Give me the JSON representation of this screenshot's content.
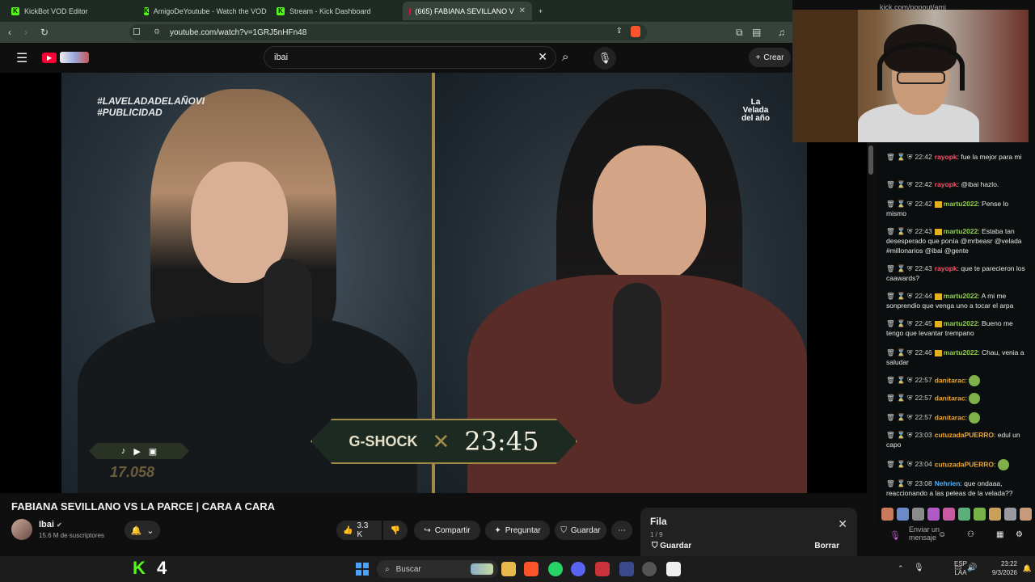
{
  "browser": {
    "tabs": [
      {
        "title": "KickBot VOD Editor",
        "icon": "kick-icon"
      },
      {
        "title": "AmigoDeYoutube - Watch the VOD o",
        "icon": "kick-icon"
      },
      {
        "title": "Stream - Kick Dashboard",
        "icon": "kick-icon"
      },
      {
        "title": "(665) FABIANA SEVILLANO V",
        "icon": "youtube-icon",
        "active": true
      }
    ],
    "new_tab": "+",
    "url": "youtube.com/watch?v=1GRJ5nHFn48"
  },
  "youtube": {
    "search_value": "ibai",
    "create_label": "Crear",
    "video": {
      "title": "FABIANA SEVILLANO VS LA PARCE | CARA A CARA",
      "hashtag_line1": "#LAVELADADELAÑOVI",
      "hashtag_line2": "#PUBLICIDAD",
      "event_logo_line1": "La",
      "event_logo_line2": "Velada",
      "event_logo_line3": "del año",
      "sponsor": "G-SHOCK",
      "countdown": "23:45",
      "counter": "17.058"
    },
    "channel": {
      "name": "Ibai",
      "subscribers": "15.6 M de suscriptores"
    },
    "actions": {
      "likes": "3.3 K",
      "share": "Compartir",
      "ask": "Preguntar",
      "save": "Guardar"
    },
    "queue": {
      "title": "Fila",
      "count": "1 / 9",
      "save": "Guardar",
      "clear": "Borrar"
    }
  },
  "kick": {
    "url": "kick.com/popout/ami",
    "chat": [
      {
        "time": "22:42",
        "user": "rayopk",
        "user_color": "#ff4f6a",
        "text": "fue la mejor para mi",
        "badge": false
      },
      {
        "time": "22:42",
        "user": "rayopk",
        "user_color": "#ff4f6a",
        "text": "@ibai hazlo.",
        "badge": false
      },
      {
        "time": "22:42",
        "user": "martu2022",
        "user_color": "#8fd44a",
        "text": "Pense lo mismo",
        "badge": true
      },
      {
        "time": "22:43",
        "user": "martu2022",
        "user_color": "#8fd44a",
        "text": "Estaba tan desesperado que ponía @mrbeasr @velada #millonarios @ibai @gente",
        "badge": true
      },
      {
        "time": "22:43",
        "user": "rayopk",
        "user_color": "#ff4f6a",
        "text": "que te parecieron los caawards?",
        "badge": false
      },
      {
        "time": "22:44",
        "user": "martu2022",
        "user_color": "#8fd44a",
        "text": "A mi me sonprendio que venga uno a tocar el arpa",
        "badge": true
      },
      {
        "time": "22:45",
        "user": "martu2022",
        "user_color": "#8fd44a",
        "text": "Bueno me tengo que levantar trempano",
        "badge": true
      },
      {
        "time": "22:46",
        "user": "martu2022",
        "user_color": "#8fd44a",
        "text": "Chau, venia a saludar",
        "badge": true
      },
      {
        "time": "22:57",
        "user": "danitarac",
        "user_color": "#f5a623",
        "text": "",
        "emote": true,
        "badge": false
      },
      {
        "time": "22:57",
        "user": "danitarac",
        "user_color": "#f5a623",
        "text": "",
        "emote": true,
        "badge": false
      },
      {
        "time": "22:57",
        "user": "danitarac",
        "user_color": "#f5a623",
        "text": "",
        "emote": true,
        "badge": false
      },
      {
        "time": "23:03",
        "user": "cutuzadaPUERRO",
        "user_color": "#f5a623",
        "text": "edul un capo",
        "badge": false
      },
      {
        "time": "23:04",
        "user": "cutuzadaPUERRO",
        "user_color": "#f5a623",
        "text": "",
        "emote": true,
        "badge": false
      },
      {
        "time": "23:08",
        "user": "Nehrien",
        "user_color": "#4fb3ff",
        "text": "que ondaaa, reaccionando a las peleas de la velada??",
        "badge": false
      }
    ],
    "chat_placeholder": "Enviar un mensaje"
  },
  "taskbar": {
    "kick_count": "4",
    "search_placeholder": "Buscar",
    "lang_line1": "ESP",
    "lang_line2": "LAA",
    "time": "23:22",
    "date": "9/3/2026"
  },
  "colors": {
    "kick_green": "#53fc18",
    "youtube_red": "#ff0033",
    "gold_accent": "#a08a48"
  }
}
